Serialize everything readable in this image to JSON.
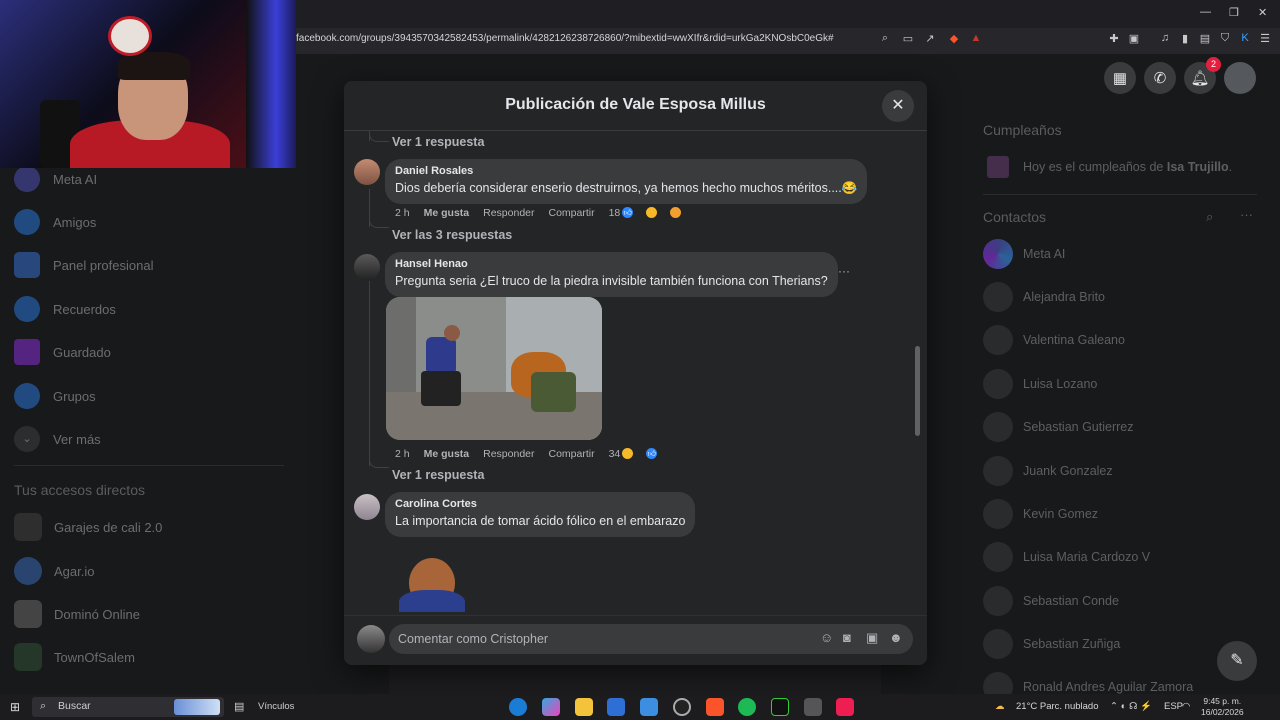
{
  "browser": {
    "url": "facebook.com/groups/3943570342582453/permalink/4282126238726860/?mibextid=wwXIfr&rdid=urkGa2KNOsbC0eGk#",
    "window_controls": [
      "—",
      "❐",
      "✕"
    ]
  },
  "left_sidebar": {
    "items": [
      {
        "label": "Meta AI",
        "icon": "meta-ai-icon",
        "color": "#5b5bd6"
      },
      {
        "label": "Amigos",
        "icon": "friends-icon",
        "color": "#2d88ff"
      },
      {
        "label": "Panel profesional",
        "icon": "dashboard-icon",
        "color": "#3b82f6"
      },
      {
        "label": "Recuerdos",
        "icon": "memories-icon",
        "color": "#2d88ff"
      },
      {
        "label": "Guardado",
        "icon": "saved-icon",
        "color": "#a033ff"
      },
      {
        "label": "Grupos",
        "icon": "groups-icon",
        "color": "#2d88ff"
      },
      {
        "label": "Ver más",
        "icon": "chevron-down-icon",
        "color": "#3a3b3c"
      }
    ],
    "shortcuts_title": "Tus accesos directos",
    "shortcuts": [
      {
        "label": "Garajes de cali 2.0",
        "color": "#4a4a4a"
      },
      {
        "label": "Agar.io",
        "color": "#3b7bd6"
      },
      {
        "label": "Dominó Online",
        "color": "#7a7a7a"
      },
      {
        "label": "TownOfSalem",
        "color": "#355e3b"
      }
    ]
  },
  "right_sidebar": {
    "birthdays_title": "Cumpleaños",
    "birthday_text_prefix": "Hoy es el cumpleaños de ",
    "birthday_name": "Isa Trujillo",
    "birthday_suffix": ".",
    "contacts_title": "Contactos",
    "contacts": [
      "Meta AI",
      "Alejandra Brito",
      "Valentina Galeano",
      "Luisa Lozano",
      "Sebastian Gutierrez",
      "Juank Gonzalez",
      "Kevin Gomez",
      "Luisa Maria Cardozo V",
      "Sebastian Conde",
      "Sebastian Zuñiga",
      "Ronald Andres Aguilar Zamora"
    ]
  },
  "top_nav": {
    "notification_count": "2"
  },
  "modal": {
    "title": "Publicación de Vale Esposa Millus",
    "close": "✕",
    "see_replies_1": "Ver 1 respuesta",
    "comments": [
      {
        "author": "Daniel Rosales",
        "text": "Dios debería considerar enserio destruirnos, ya hemos hecho muchos méritos....😂",
        "time": "2 h",
        "like": "Me gusta",
        "reply": "Responder",
        "share": "Compartir",
        "reactions_count": "18",
        "see_replies": "Ver las 3 respuestas"
      },
      {
        "author": "Hansel Henao",
        "text": "Pregunta seria ¿El truco de la piedra invisible también funciona con Therians?",
        "time": "2 h",
        "like": "Me gusta",
        "reply": "Responder",
        "share": "Compartir",
        "reactions_count": "34",
        "more": "···",
        "see_replies": "Ver 1 respuesta"
      },
      {
        "author": "Carolina Cortes",
        "text": "La importancia de tomar ácido fólico en el embarazo"
      }
    ],
    "comment_placeholder": "Comentar como Cristopher"
  },
  "taskbar": {
    "search_label": "Buscar",
    "links_label": "Vínculos",
    "weather": "21°C  Parc. nublado",
    "lang": "ESP",
    "time": "9:45 p. m.",
    "date": "16/02/2026"
  }
}
